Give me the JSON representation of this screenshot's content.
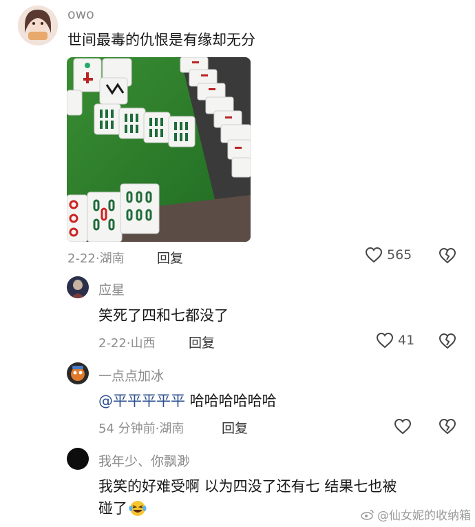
{
  "comments": [
    {
      "username": "owo",
      "text": "世间最毒的仇恨是有缘却无分",
      "date": "2-22",
      "location": "湖南",
      "reply_label": "回复",
      "likes": "565"
    },
    {
      "username": "应星",
      "text": "笑死了四和七都没了",
      "date": "2-22",
      "location": "山西",
      "reply_label": "回复",
      "likes": "41"
    },
    {
      "username": "一点点加冰",
      "mention": "@平平平平平",
      "text": " 哈哈哈哈哈哈",
      "date": "54 分钟前",
      "location": "湖南",
      "reply_label": "回复"
    },
    {
      "username": "我年少、你飘渺",
      "text_line1": "我笑的好难受啊 以为四没了还有七 结果七也被",
      "text_line2": "碰了"
    }
  ],
  "separator": "·",
  "watermark": "@仙女妮的收纳箱",
  "icons": {
    "like": "heart-outline-icon",
    "dislike": "broken-heart-icon",
    "emoji": "laughing-crying-emoji-icon"
  },
  "colors": {
    "table_green": "#2f7d2a",
    "mention_blue": "#2b4f8f"
  }
}
